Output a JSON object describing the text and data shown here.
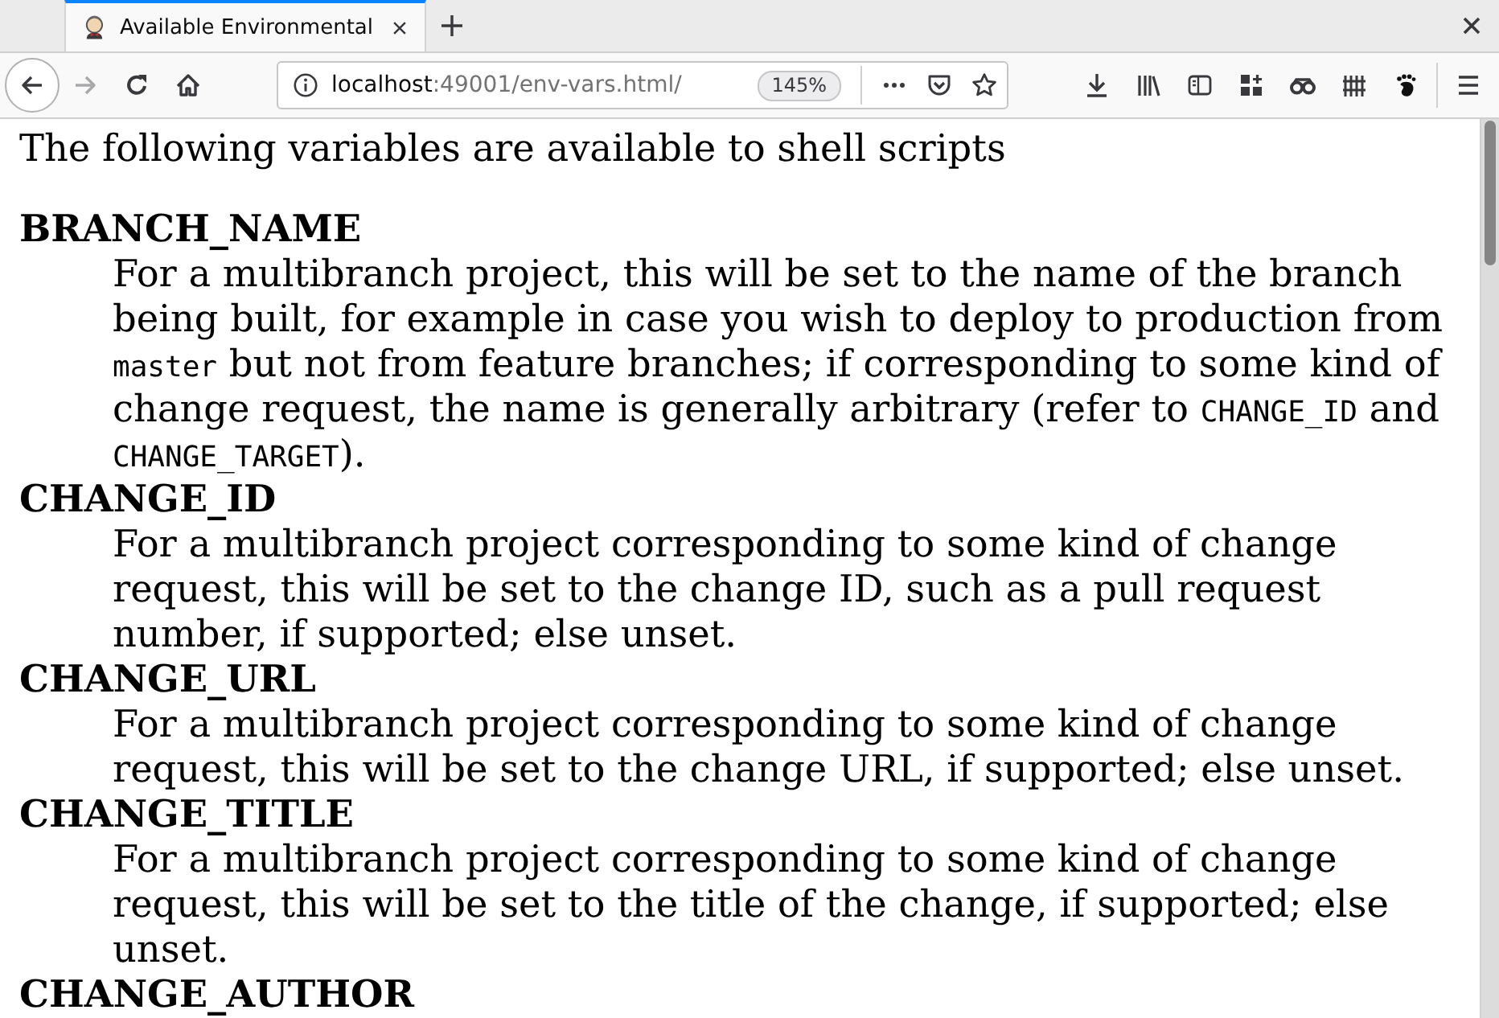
{
  "browser": {
    "tabs": [
      {
        "title": "Available Environmental",
        "selected": true
      }
    ],
    "nav_buttons": [
      {
        "kind": "back",
        "disabled": false
      },
      {
        "kind": "forward",
        "disabled": true
      },
      {
        "kind": "reload",
        "disabled": false
      },
      {
        "kind": "home",
        "disabled": false
      }
    ],
    "address_bar": {
      "host": "localhost",
      "path": ":49001/env-vars.html/",
      "zoom": "145%"
    }
  },
  "page": {
    "intro": "The following variables are available to shell scripts",
    "variables": [
      {
        "name": "BRANCH_NAME",
        "description": [
          {
            "kind": "text",
            "text": "For a multibranch project, this will be set to the name of the branch being built, for example in case you wish to deploy to production from "
          },
          {
            "kind": "code",
            "text": "master"
          },
          {
            "kind": "text",
            "text": " but not from feature branches; if corresponding to some kind of change request, the name is generally arbitrary (refer to "
          },
          {
            "kind": "code",
            "text": "CHANGE_ID"
          },
          {
            "kind": "text",
            "text": " and "
          },
          {
            "kind": "code",
            "text": "CHANGE_TARGET"
          },
          {
            "kind": "text",
            "text": ")."
          }
        ]
      },
      {
        "name": "CHANGE_ID",
        "description": [
          {
            "kind": "text",
            "text": "For a multibranch project corresponding to some kind of change request, this will be set to the change ID, such as a pull request number, if supported; else unset."
          }
        ]
      },
      {
        "name": "CHANGE_URL",
        "description": [
          {
            "kind": "text",
            "text": "For a multibranch project corresponding to some kind of change request, this will be set to the change URL, if supported; else unset."
          }
        ]
      },
      {
        "name": "CHANGE_TITLE",
        "description": [
          {
            "kind": "text",
            "text": "For a multibranch project corresponding to some kind of change request, this will be set to the title of the change, if supported; else unset."
          }
        ]
      },
      {
        "name": "CHANGE_AUTHOR"
      }
    ]
  }
}
